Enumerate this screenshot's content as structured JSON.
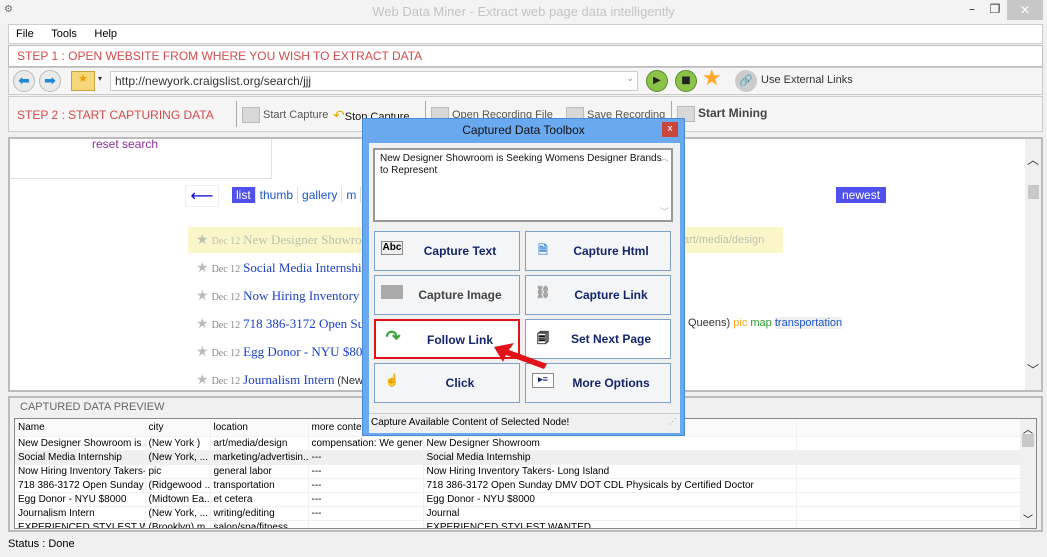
{
  "window": {
    "title": "Web Data Miner -  Extract web page data intelligently",
    "minimize": "–",
    "maximize": "❐",
    "close": "✕"
  },
  "menu": [
    "File",
    "Tools",
    "Help"
  ],
  "step1": {
    "label": "STEP 1 : OPEN WEBSITE FROM WHERE YOU WISH TO EXTRACT DATA",
    "url": "http://newyork.craigslist.org/search/jjj",
    "external_links_label": "Use External Links"
  },
  "step2": {
    "label": "STEP 2 : START CAPTURING DATA",
    "start_capture": "Start Capture",
    "stop_capture": "Stop Capture",
    "open_recording": "Open Recording File",
    "save_recording": "Save Recording",
    "start_mining": "Start Mining"
  },
  "browser": {
    "reset_search": "reset search",
    "back_arrow": "⟵",
    "view_tabs": [
      "list",
      "thumb",
      "gallery",
      "m"
    ],
    "active_view": "list",
    "sort": "newest",
    "listings": [
      {
        "date": "Dec 12",
        "title": "New Designer Showroo",
        "highlighted": true
      },
      {
        "date": "Dec 12",
        "title": "Social Media Internship"
      },
      {
        "date": "Dec 12",
        "title": "Now Hiring Inventory T"
      },
      {
        "date": "Dec 12",
        "title": "718 386-3172 Open Su"
      },
      {
        "date": "Dec 12",
        "title": "Egg Donor - NYU $800"
      },
      {
        "date": "Dec 12",
        "title": "Journalism Intern",
        "note": "(New Y"
      }
    ],
    "highlighted_category": "art/media/design",
    "queens_row": {
      "prefix": "Queens)",
      "pic": "pic",
      "map": "map",
      "category": "transportation"
    }
  },
  "preview": {
    "header": "CAPTURED DATA PREVIEW",
    "columns": [
      "Name",
      "city",
      "location",
      "more content",
      "",
      ""
    ],
    "rows": [
      [
        "New Designer Showroom is S...",
        "(New York )",
        "art/media/design",
        "compensation: We gener...",
        "New Designer Showroom",
        ""
      ],
      [
        "Social Media Internship",
        "(New York, ...",
        "marketing/advertisin...",
        "---",
        "Social Media Internship",
        ""
      ],
      [
        "Now Hiring Inventory Takers- ...",
        "pic",
        "general labor",
        "---",
        "Now Hiring Inventory Takers- Long Island",
        ""
      ],
      [
        "718 386-3172 Open Sunday ...",
        "(Ridgewood ...",
        "transportation",
        "---",
        "718 386-3172 Open Sunday DMV DOT CDL Physicals by Certified Doctor",
        ""
      ],
      [
        "Egg Donor - NYU $8000",
        "(Midtown Ea...",
        "et cetera",
        "---",
        "Egg Donor - NYU $8000",
        ""
      ],
      [
        "Journalism Intern",
        "(New York, ...",
        "writing/editing",
        "---",
        "Journal",
        ""
      ],
      [
        "EXPERIENCED STYLEST W...",
        "(Brooklyn) m...",
        "salon/spa/fitness",
        "",
        "EXPERIENCED STYLEST WANTED",
        ""
      ]
    ],
    "selected_row": 1
  },
  "status": "Status :  Done",
  "toolbox": {
    "title": "Captured Data Toolbox",
    "close": "x",
    "captured_text": "New Designer Showroom is Seeking Womens Designer Brands to Represent",
    "buttons": [
      {
        "label": "Capture Text",
        "icon": "abc-text-icon"
      },
      {
        "label": "Capture Html",
        "icon": "html-file-icon"
      },
      {
        "label": "Capture Image",
        "icon": "image-icon"
      },
      {
        "label": "Capture Link",
        "icon": "link-chain-icon"
      },
      {
        "label": "Follow Link",
        "icon": "green-arrow-icon"
      },
      {
        "label": "Set Next Page",
        "icon": "pages-icon"
      },
      {
        "label": "Click",
        "icon": "hand-click-icon"
      },
      {
        "label": "More Options",
        "icon": "options-list-icon"
      }
    ],
    "status": "Capture Available Content of Selected Node!"
  }
}
